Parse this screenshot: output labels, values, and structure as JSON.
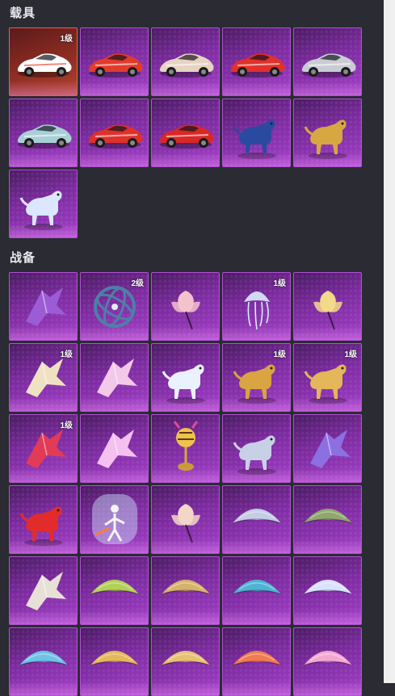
{
  "sections": [
    {
      "title": "载具",
      "items": [
        {
          "name": "race-car-white-red",
          "icon": "car-icon",
          "badge": "1级",
          "theme": "orange",
          "color": "#ffffff",
          "accent": "#e53b2f"
        },
        {
          "name": "sports-car-red-1",
          "icon": "car-icon",
          "badge": "",
          "color": "#e43a2b"
        },
        {
          "name": "sports-car-beige",
          "icon": "car-icon",
          "badge": "",
          "color": "#e6d3c2"
        },
        {
          "name": "sports-car-red-2",
          "icon": "car-icon",
          "badge": "",
          "color": "#e2302a"
        },
        {
          "name": "sports-car-silver",
          "icon": "car-icon",
          "badge": "",
          "color": "#c9ccd4"
        },
        {
          "name": "sports-car-teal",
          "icon": "car-icon",
          "badge": "",
          "color": "#a9cfd6"
        },
        {
          "name": "supercar-red-1",
          "icon": "car-icon",
          "badge": "",
          "color": "#e0302a"
        },
        {
          "name": "supercar-red-2",
          "icon": "car-icon",
          "badge": "",
          "color": "#d82825"
        },
        {
          "name": "armored-wolf-mount",
          "icon": "wolf-icon",
          "badge": "",
          "color": "#2a4aa0"
        },
        {
          "name": "golden-horse-mount",
          "icon": "horse-icon",
          "badge": "",
          "color": "#d7a742"
        },
        {
          "name": "crystal-unicorn-mount",
          "icon": "unicorn-icon",
          "badge": "",
          "color": "#dbe7ff"
        }
      ]
    },
    {
      "title": "战备",
      "items": [
        {
          "name": "purple-vine-item",
          "icon": "vine-icon",
          "badge": "",
          "color": "#9b5cd6"
        },
        {
          "name": "gyroscope-item",
          "icon": "gyroscope-icon",
          "badge": "2级",
          "color": "#4d7fa8"
        },
        {
          "name": "pink-flower-item",
          "icon": "flower-icon",
          "badge": "",
          "color": "#f3c3cd"
        },
        {
          "name": "jellyfish-item",
          "icon": "jellyfish-icon",
          "badge": "1级",
          "color": "#d8ecff"
        },
        {
          "name": "golden-leaf-item",
          "icon": "leaf-icon",
          "badge": "",
          "color": "#f3d98a"
        },
        {
          "name": "moon-cart-item",
          "icon": "cart-icon",
          "badge": "1级",
          "color": "#efe2c2"
        },
        {
          "name": "crystal-shards-item",
          "icon": "shards-icon",
          "badge": "",
          "color": "#f2c9e8"
        },
        {
          "name": "white-cat-item",
          "icon": "cat-icon",
          "badge": "",
          "color": "#eaf2ff"
        },
        {
          "name": "golden-dragon-item",
          "icon": "dragon-icon",
          "badge": "1级",
          "color": "#d9a441"
        },
        {
          "name": "pegasus-cart-item",
          "icon": "pegasus-icon",
          "badge": "1级",
          "color": "#e3b75a"
        },
        {
          "name": "red-dagger-item",
          "icon": "dagger-icon",
          "badge": "1级",
          "color": "#e23b56"
        },
        {
          "name": "crystal-bulb-item",
          "icon": "bulb-icon",
          "badge": "",
          "color": "#f3c0f0"
        },
        {
          "name": "bee-balloon-item",
          "icon": "bee-icon",
          "badge": "",
          "color": "#f0c24a"
        },
        {
          "name": "serpent-dragon-item",
          "icon": "serpent-icon",
          "badge": "",
          "color": "#c8d0e6"
        },
        {
          "name": "violet-blade-item",
          "icon": "blade-icon",
          "badge": "",
          "color": "#8c6fe0"
        },
        {
          "name": "red-creature-item",
          "icon": "creature-icon",
          "badge": "",
          "color": "#e22c2c"
        },
        {
          "name": "portal-figure-item",
          "icon": "portal-icon",
          "badge": "",
          "color": "#cfe6ff"
        },
        {
          "name": "cherry-blossom-item",
          "icon": "blossom-icon",
          "badge": "",
          "color": "#f2d7c8"
        },
        {
          "name": "silver-parachute",
          "icon": "parachute-icon",
          "badge": "",
          "color": "#c3cde3"
        },
        {
          "name": "green-leaf-glider",
          "icon": "glider-icon",
          "badge": "",
          "color": "#8fa86b"
        },
        {
          "name": "dark-scroll-item",
          "icon": "scroll-icon",
          "badge": "",
          "color": "#e8e0d6"
        },
        {
          "name": "green-mosaic-parachute",
          "icon": "parachute-icon",
          "badge": "",
          "color": "#b3d05a"
        },
        {
          "name": "gold-ornate-parachute",
          "icon": "parachute-icon",
          "badge": "",
          "color": "#d6b36a"
        },
        {
          "name": "ocean-parachute",
          "icon": "parachute-icon",
          "badge": "",
          "color": "#4fb4d3"
        },
        {
          "name": "jellyfish-parachute",
          "icon": "parachute-icon",
          "badge": "",
          "color": "#d9e3ff"
        },
        {
          "name": "painted-parachute",
          "icon": "parachute-icon",
          "badge": "",
          "color": "#6ec2e6"
        },
        {
          "name": "golden-feather-parachute",
          "icon": "parachute-icon",
          "badge": "",
          "color": "#e4b85a"
        },
        {
          "name": "gold-pattern-parachute",
          "icon": "parachute-icon",
          "badge": "",
          "color": "#e7c173"
        },
        {
          "name": "doll-face-parachute",
          "icon": "parachute-icon",
          "badge": "",
          "color": "#f07b4e"
        },
        {
          "name": "pink-floral-parachute",
          "icon": "parachute-icon",
          "badge": "",
          "color": "#f3a8d1"
        }
      ]
    }
  ]
}
